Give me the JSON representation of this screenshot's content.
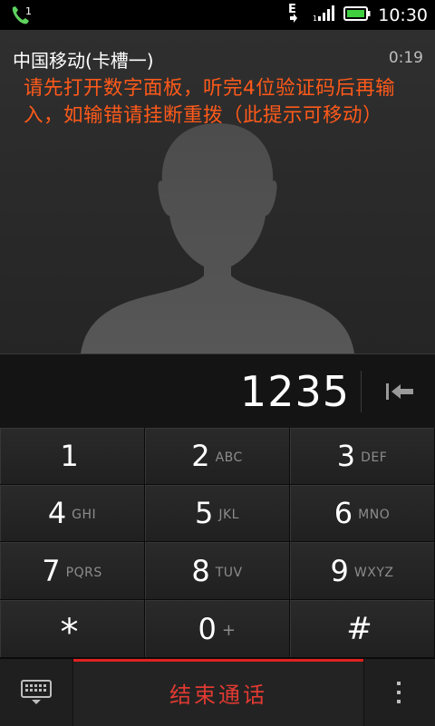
{
  "status_bar": {
    "call_icon": "phone-call-icon",
    "call_count": "1",
    "network": "E",
    "signal_icon": "signal-bars-icon",
    "battery_icon": "battery-full-icon",
    "time": "10:30"
  },
  "call": {
    "carrier": "中国移动(卡槽一)",
    "duration": "0:19",
    "notice": "请先打开数字面板，听完4位验证码后再输入，如输错请挂断重拨（此提示可移动）",
    "avatar_icon": "default-contact-silhouette-icon"
  },
  "dialer": {
    "number": "1235",
    "backspace_icon": "backspace-icon"
  },
  "keypad": [
    {
      "digit": "1",
      "letters": ""
    },
    {
      "digit": "2",
      "letters": "ABC"
    },
    {
      "digit": "3",
      "letters": "DEF"
    },
    {
      "digit": "4",
      "letters": "GHI"
    },
    {
      "digit": "5",
      "letters": "JKL"
    },
    {
      "digit": "6",
      "letters": "MNO"
    },
    {
      "digit": "7",
      "letters": "PQRS"
    },
    {
      "digit": "8",
      "letters": "TUV"
    },
    {
      "digit": "9",
      "letters": "WXYZ"
    },
    {
      "digit": "*",
      "letters": ""
    },
    {
      "digit": "0",
      "letters": "+"
    },
    {
      "digit": "#",
      "letters": ""
    }
  ],
  "bottom_bar": {
    "keyboard_icon": "hide-keypad-icon",
    "end_call_label": "结束通话",
    "more_icon": "more-options-icon"
  },
  "colors": {
    "notice": "#ff5a1a",
    "end_call": "#e03a32",
    "accent_line": "#e02020",
    "call_icon": "#5fd35f"
  }
}
